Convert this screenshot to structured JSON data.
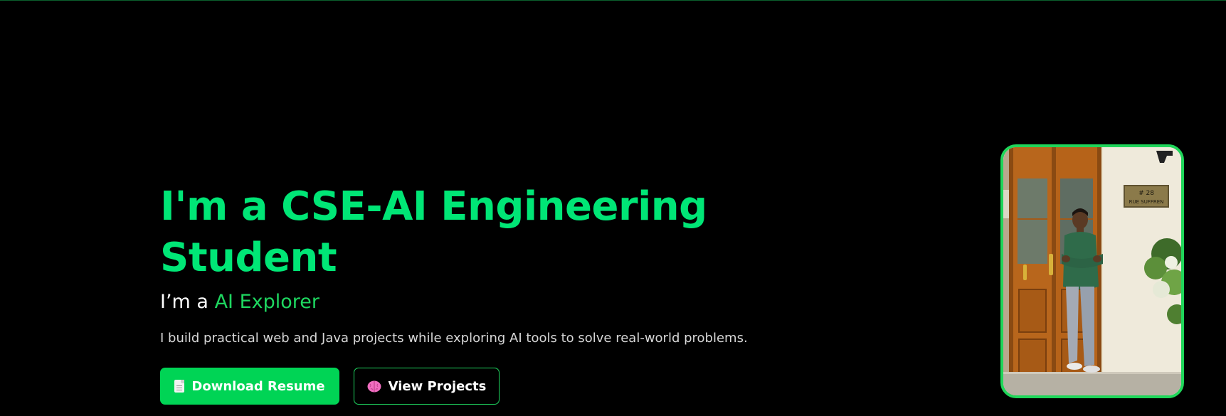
{
  "hero": {
    "headline": "I'm a CSE-AI Engineering Student",
    "subline_prefix": "I’m a ",
    "subline_accent": "AI Explorer",
    "description": "I build practical web and Java projects while exploring AI tools to solve real-world problems."
  },
  "buttons": {
    "download_resume": {
      "label": "Download Resume",
      "icon": "document-icon"
    },
    "view_projects": {
      "label": "View Projects",
      "icon": "brain-icon"
    }
  },
  "photo": {
    "plaque_number": "# 28",
    "plaque_street": "RUE SUFFREN"
  },
  "colors": {
    "background": "#000000",
    "accent_green": "#00e676",
    "button_green": "#00d455",
    "border_green": "#1fd65a",
    "text_white": "#ffffff",
    "text_muted": "#d6d6d6"
  }
}
